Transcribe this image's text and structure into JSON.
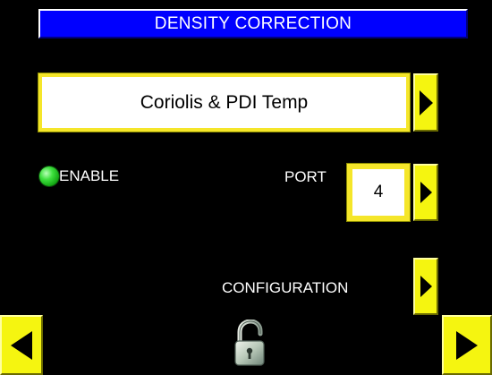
{
  "header": {
    "title": "DENSITY CORRECTION"
  },
  "mode": {
    "selected_value": "Coriolis & PDI Temp"
  },
  "enable": {
    "label": "ENABLE",
    "state": "on",
    "indicator_color": "#22cc22"
  },
  "port": {
    "label": "PORT",
    "value": "4"
  },
  "configuration": {
    "label": "CONFIGURATION"
  },
  "colors": {
    "title_bar": "#0000ff",
    "button_yellow": "#f5f510",
    "background": "#000000"
  },
  "icons": {
    "mode_next": "right-arrow-icon",
    "port_next": "right-arrow-icon",
    "config_next": "right-arrow-icon",
    "nav_prev": "left-arrow-icon",
    "nav_next": "right-arrow-icon",
    "lock": "unlocked-padlock-icon"
  }
}
